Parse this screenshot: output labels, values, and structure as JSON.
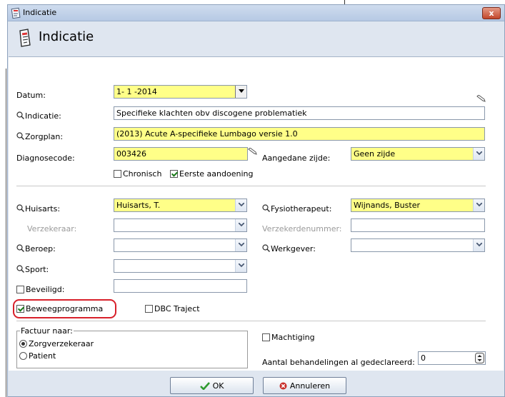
{
  "window": {
    "title": "Indicatie",
    "heading": "Indicatie",
    "close_label": "x"
  },
  "form": {
    "datum": {
      "label": "Datum:",
      "value": "1- 1 -2014"
    },
    "indicatie": {
      "label": "Indicatie:",
      "value": "Specifieke klachten obv discogene problematiek"
    },
    "zorgplan": {
      "label": "Zorgplan:",
      "value": "(2013) Acute A-specifieke Lumbago versie 1.0"
    },
    "diagnosecode": {
      "label": "Diagnosecode:",
      "value": "003426"
    },
    "aangedane_zijde": {
      "label": "Aangedane zijde:",
      "value": "Geen zijde"
    },
    "chronisch": {
      "label": "Chronisch",
      "checked": false
    },
    "eerste_aandoening": {
      "label": "Eerste aandoening",
      "checked": true
    },
    "huisarts": {
      "label": "Huisarts:",
      "value": "Huisarts, T."
    },
    "fysiotherapeut": {
      "label": "Fysiotherapeut:",
      "value": "Wijnands, Buster"
    },
    "verzekeraar": {
      "label": "Verzekeraar:",
      "value": ""
    },
    "verzekerdenummer": {
      "label": "Verzekerdenummer:",
      "value": ""
    },
    "beroep": {
      "label": "Beroep:",
      "value": ""
    },
    "werkgever": {
      "label": "Werkgever:",
      "value": ""
    },
    "sport": {
      "label": "Sport:",
      "value": ""
    },
    "beveiligd": {
      "label": "Beveiligd:",
      "checked": false,
      "value": ""
    },
    "beweegprogramma": {
      "label": "Beweegprogramma",
      "checked": true
    },
    "dbc_traject": {
      "label": "DBC Traject",
      "checked": false
    },
    "factuur": {
      "legend": "Factuur naar:",
      "options": [
        {
          "label": "Zorgverzekeraar",
          "selected": true
        },
        {
          "label": "Patient",
          "selected": false
        }
      ]
    },
    "machtiging": {
      "label": "Machtiging",
      "checked": false
    },
    "aantal_behandelingen": {
      "label": "Aantal behandelingen al gedeclareerd:",
      "value": "0"
    }
  },
  "buttons": {
    "ok": "OK",
    "annuleren": "Annuleren"
  },
  "colors": {
    "required_field": "#ffff88",
    "highlight": "#d8202a",
    "title_bar": "#b6c9e4"
  }
}
